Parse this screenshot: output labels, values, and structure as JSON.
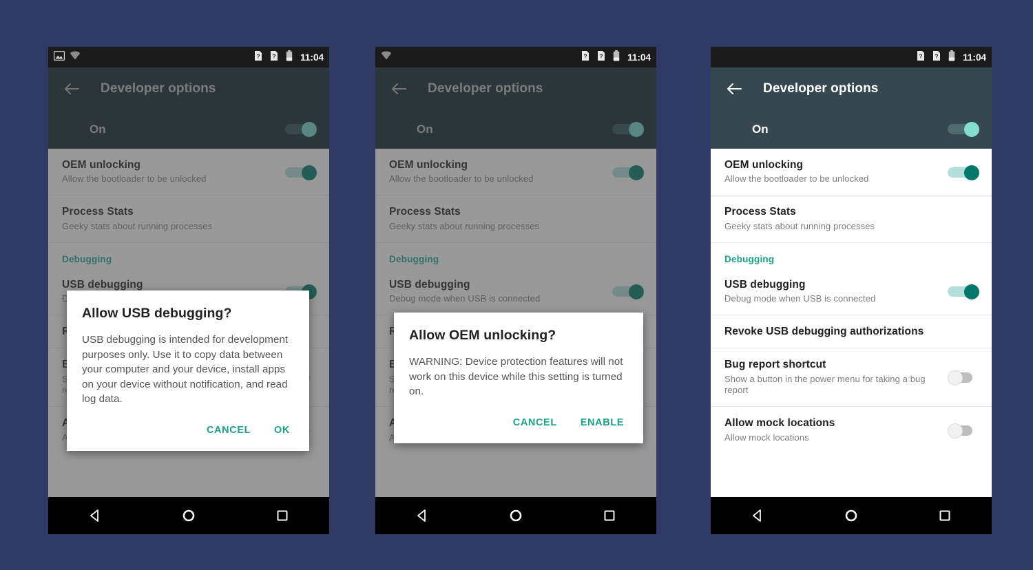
{
  "background_color": "#2e3a63",
  "accent_color": "#1aa08b",
  "toolbar_color": "#37474f",
  "switch_on_color": "#00796b",
  "statusbar": {
    "time": "11:04",
    "icons_panel1": [
      "screenshot-icon",
      "wifi-icon"
    ],
    "icons_panel2": [
      "wifi-icon"
    ],
    "icons_right": [
      "sim-missing-icon",
      "sim-missing-icon",
      "battery-icon"
    ]
  },
  "toolbar": {
    "back_label": "←",
    "title": "Developer options"
  },
  "master_switch": {
    "label": "On",
    "state": "on"
  },
  "navbar": {
    "back": "back-triangle-icon",
    "home": "home-circle-icon",
    "recents": "recents-square-icon"
  },
  "settings": [
    {
      "id": "oem-unlocking",
      "title": "OEM unlocking",
      "subtitle": "Allow the bootloader to be unlocked",
      "switch": "on"
    },
    {
      "id": "process-stats",
      "title": "Process Stats",
      "subtitle": "Geeky stats about running processes",
      "switch": null
    },
    {
      "id": "debugging-section",
      "section": "Debugging"
    },
    {
      "id": "usb-debugging",
      "title": "USB debugging",
      "subtitle": "Debug mode when USB is connected",
      "switch": "on"
    },
    {
      "id": "revoke-usb-debugging",
      "title": "Revoke USB debugging authorizations",
      "subtitle": "",
      "switch": null
    },
    {
      "id": "bug-report-shortcut",
      "title": "Bug report shortcut",
      "subtitle": "Show a button in the power menu for taking a bug report",
      "switch": "off"
    },
    {
      "id": "allow-mock-locations",
      "title": "Allow mock locations",
      "subtitle": "Allow mock locations",
      "switch": "off"
    }
  ],
  "panels": [
    {
      "id": "panel-usb-debugging",
      "dialog": {
        "title": "Allow USB debugging?",
        "body": "USB debugging is intended for development purposes only. Use it to copy data between your computer and your device, install apps on your device without notification, and read log data.",
        "cancel": "CANCEL",
        "confirm": "OK"
      }
    },
    {
      "id": "panel-oem-unlocking",
      "dialog": {
        "title": "Allow OEM unlocking?",
        "body": "WARNING: Device protection features will not work on this device while this setting is turned on.",
        "cancel": "CANCEL",
        "confirm": "ENABLE"
      }
    },
    {
      "id": "panel-developer-options",
      "dialog": null
    }
  ]
}
